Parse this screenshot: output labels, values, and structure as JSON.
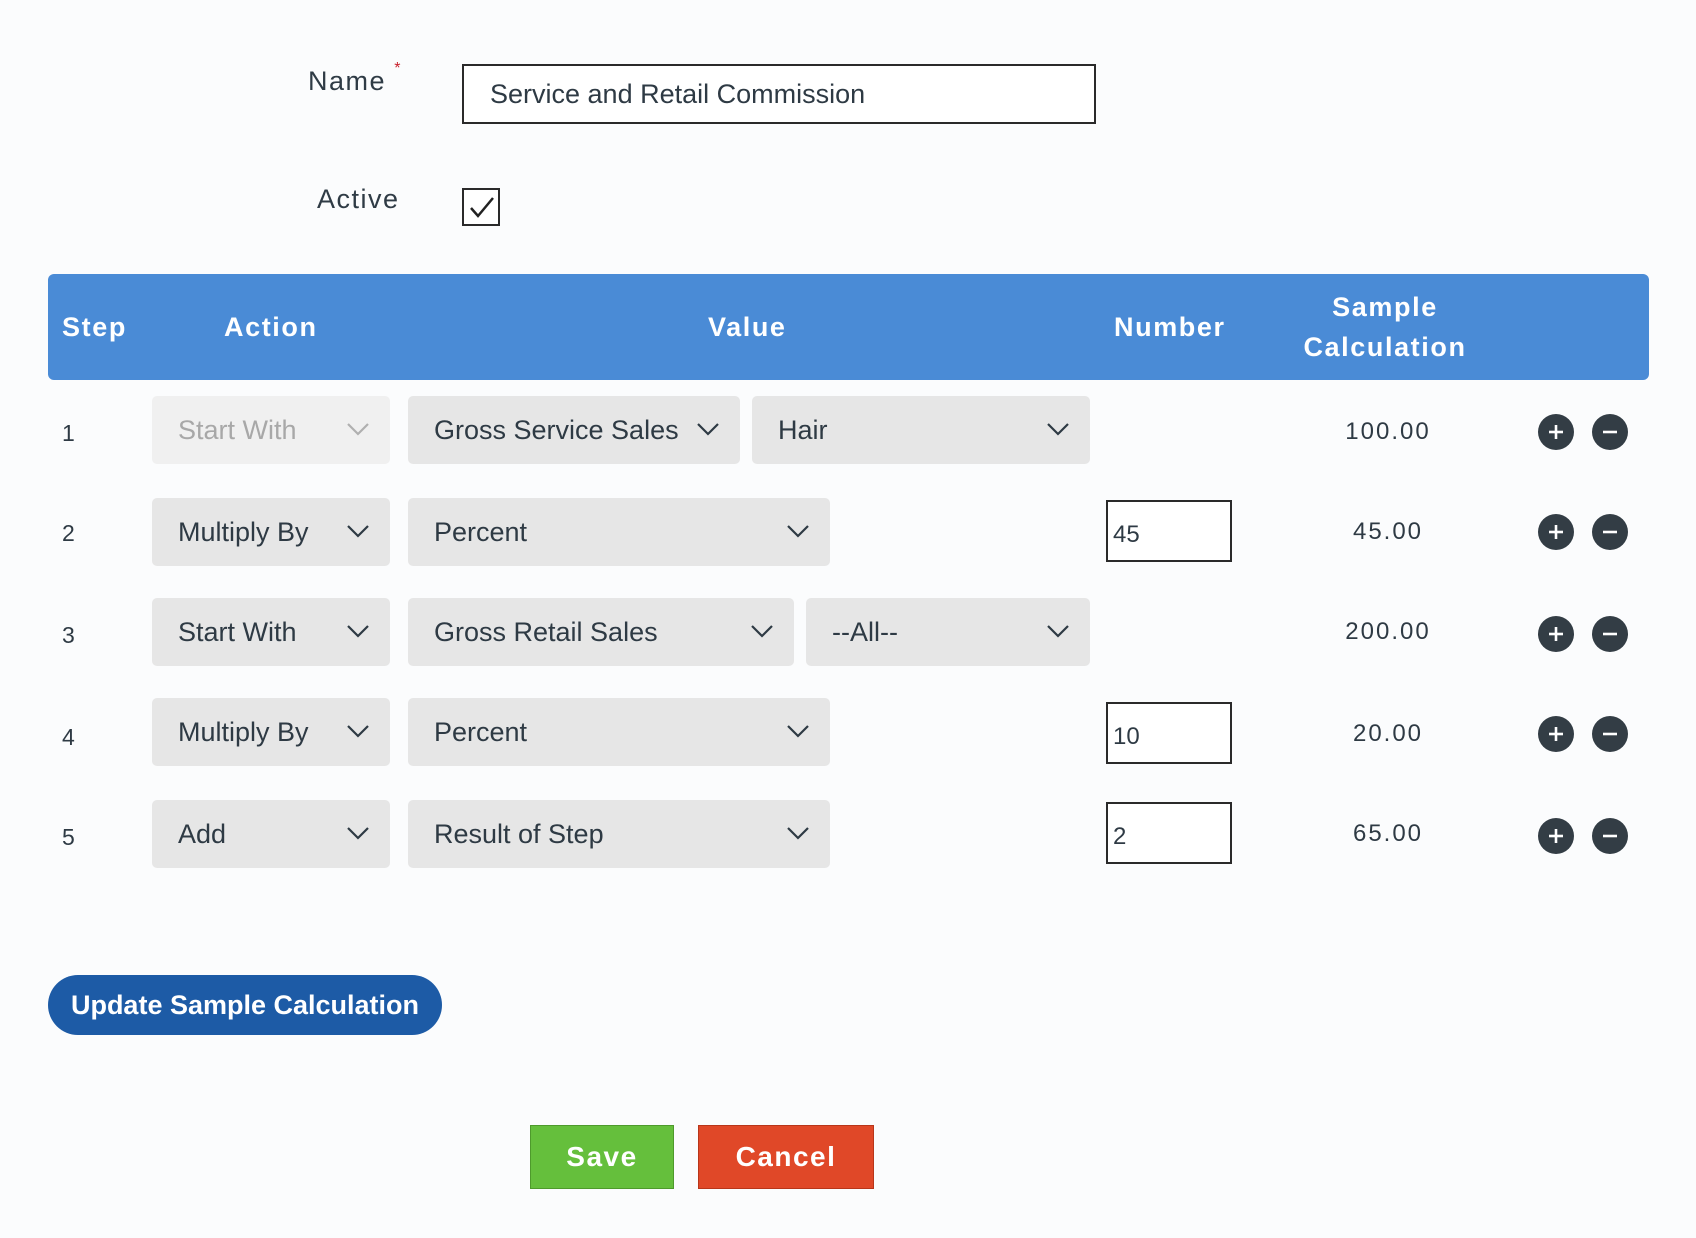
{
  "form": {
    "name_label": "Name",
    "required_marker": "*",
    "name_value": "Service and Retail Commission",
    "active_label": "Active",
    "active_checked": true
  },
  "table": {
    "headers": {
      "step": "Step",
      "action": "Action",
      "value": "Value",
      "number": "Number",
      "sample_line1": "Sample",
      "sample_line2": "Calculation"
    },
    "rows": [
      {
        "step": "1",
        "action": "Start With",
        "action_disabled": true,
        "value": "Gross Service Sales",
        "subvalue": "Hair",
        "number": "",
        "sample": "100.00"
      },
      {
        "step": "2",
        "action": "Multiply By",
        "value": "Percent",
        "subvalue": "",
        "number": "45",
        "sample": "45.00"
      },
      {
        "step": "3",
        "action": "Start With",
        "value": "Gross Retail Sales",
        "subvalue": "--All--",
        "number": "",
        "sample": "200.00"
      },
      {
        "step": "4",
        "action": "Multiply By",
        "value": "Percent",
        "subvalue": "",
        "number": "10",
        "sample": "20.00"
      },
      {
        "step": "5",
        "action": "Add",
        "value": "Result of Step",
        "subvalue": "",
        "number": "2",
        "sample": "65.00"
      }
    ]
  },
  "buttons": {
    "update": "Update Sample Calculation",
    "save": "Save",
    "cancel": "Cancel"
  },
  "colors": {
    "header_bg": "#4a8bd6",
    "update_bg": "#1d5ba6",
    "save_bg": "#65bf3c",
    "cancel_bg": "#e04828",
    "round_btn": "#333d45"
  }
}
